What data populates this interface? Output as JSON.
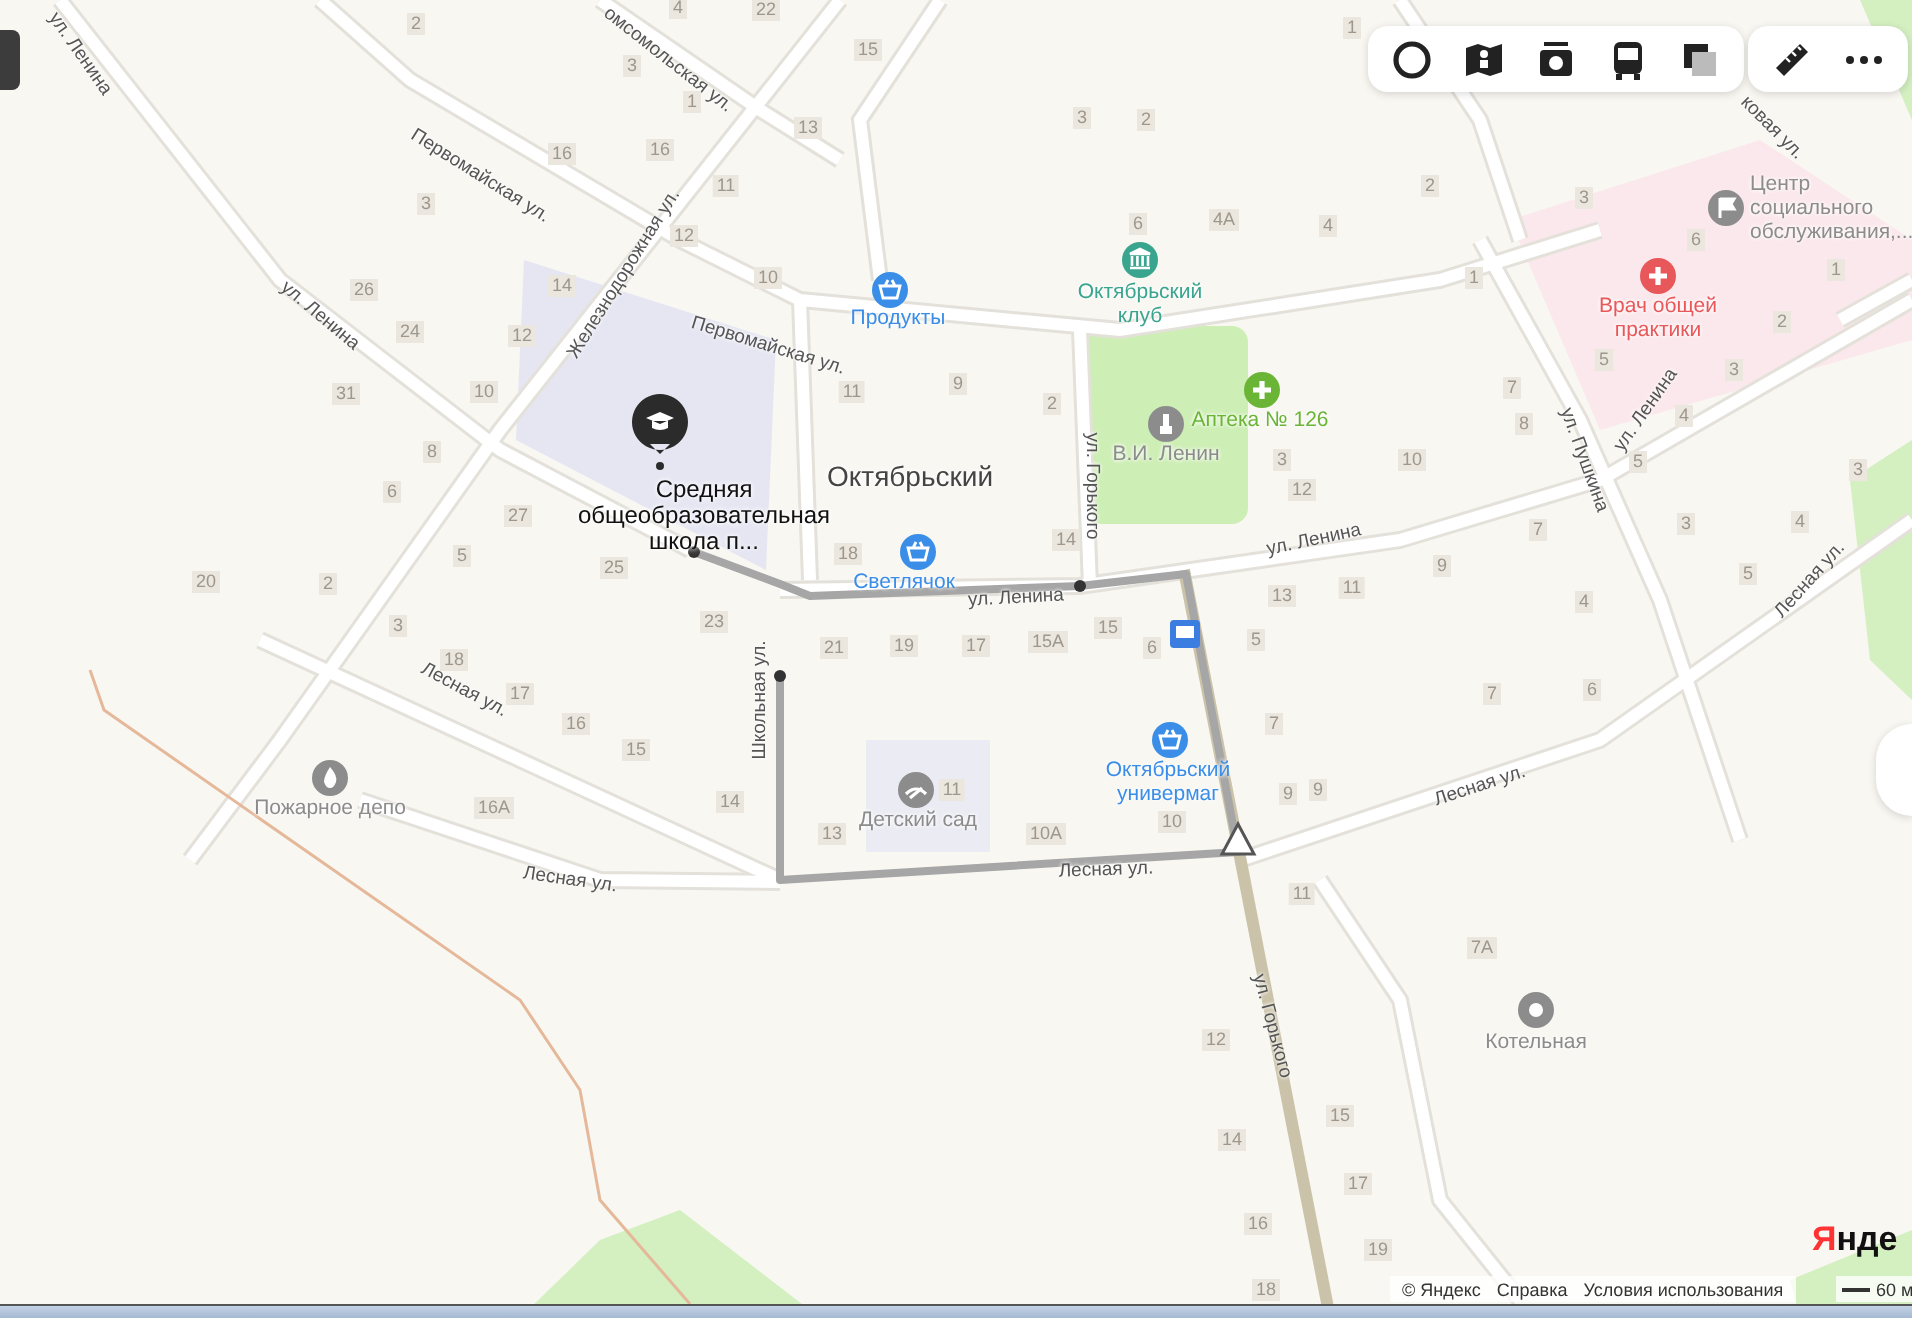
{
  "place_name": "Октябрьский",
  "selected_place": {
    "name": "Средняя общеобразовательная школа п..."
  },
  "streets": [
    "ул. Ленина",
    "омсомольская ул.",
    "Первомайская ул.",
    "Железнодорожная ул.",
    "ул. Ленина",
    "Первомайская ул.",
    "ул. Горького",
    "ул. Ленина",
    "ул. Ленина",
    "Школьная ул.",
    "ул. Пушкина",
    "ул. Ленина",
    "ковая ул.",
    "Лесная ул.",
    "Лесная ул.",
    "Лесная ул.",
    "Лесная ул.",
    "Лесная ул.",
    "ул. Горького"
  ],
  "pois": [
    {
      "name": "Продукты",
      "kind": "shop",
      "color": "#3b8ee8"
    },
    {
      "name": "Октябрьский клуб",
      "kind": "culture",
      "color": "#3aa58f"
    },
    {
      "name": "Аптека № 126",
      "kind": "pharmacy",
      "color": "#6ab536"
    },
    {
      "name": "В.И. Ленин",
      "kind": "monument",
      "color": "#8c8c8c"
    },
    {
      "name": "Светлячок",
      "kind": "shop",
      "color": "#3b8ee8"
    },
    {
      "name": "Октябрьский универмаг",
      "kind": "shop",
      "color": "#3b8ee8"
    },
    {
      "name": "Детский сад",
      "kind": "kindergarten",
      "color": "#8c8c8c"
    },
    {
      "name": "Пожарное депо",
      "kind": "fire",
      "color": "#8c8c8c"
    },
    {
      "name": "Котельная",
      "kind": "boiler",
      "color": "#8c8c8c"
    },
    {
      "name": "Центр социального обслуживания,...",
      "kind": "social",
      "color": "#8c8c8c"
    },
    {
      "name": "Врач общей практики",
      "kind": "clinic",
      "color": "#e8575a"
    }
  ],
  "house_numbers": [
    "2",
    "4",
    "22",
    "3",
    "1",
    "15",
    "13",
    "16",
    "16",
    "11",
    "3",
    "12",
    "14",
    "10",
    "26",
    "24",
    "12",
    "31",
    "10",
    "11",
    "9",
    "8",
    "6",
    "27",
    "5",
    "25",
    "18",
    "20",
    "2",
    "3",
    "23",
    "21",
    "19",
    "1",
    "3",
    "2",
    "6",
    "4А",
    "4",
    "2",
    "3",
    "6",
    "1",
    "1",
    "2",
    "5",
    "3",
    "2",
    "7",
    "8",
    "4",
    "3",
    "10",
    "5",
    "3",
    "12",
    "14",
    "7",
    "3",
    "4",
    "13",
    "11",
    "9",
    "4",
    "5",
    "17",
    "15А",
    "15",
    "6",
    "5",
    "18",
    "17",
    "16",
    "15",
    "16А",
    "14",
    "11",
    "13",
    "7",
    "7",
    "6",
    "9",
    "9",
    "10А",
    "10",
    "11",
    "7А",
    "12",
    "15",
    "14",
    "17",
    "16",
    "19",
    "18"
  ],
  "footer": {
    "copyright": "© Яндекс",
    "links": [
      "Справка",
      "Условия использования"
    ],
    "scale": "60 м",
    "logo": "Янде"
  }
}
